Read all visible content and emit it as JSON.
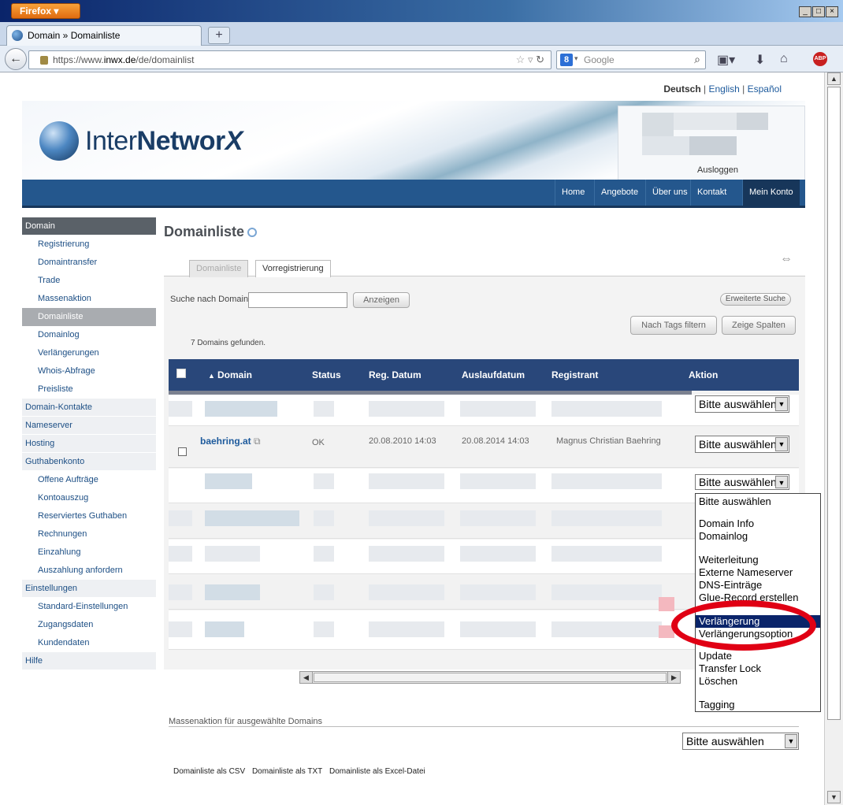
{
  "browser": {
    "app_button": "Firefox",
    "tab_title": "Domain » Domainliste",
    "url_prefix": "https://www.",
    "url_host": "inwx.de",
    "url_path": "/de/domainlist",
    "search_placeholder": "Google",
    "new_tab_label": "+"
  },
  "header": {
    "lang_current": "Deutsch",
    "lang_en": "English",
    "lang_es": "Español",
    "logo_light": "Inter",
    "logo_bold": "Networ",
    "logo_x": "X",
    "logout": "Ausloggen"
  },
  "topnav": [
    "Home",
    "Angebote",
    "Über uns",
    "Kontakt",
    "Mein Konto"
  ],
  "sidebar": [
    {
      "label": "Domain",
      "type": "section",
      "state": "dark"
    },
    {
      "label": "Registrierung",
      "type": "item"
    },
    {
      "label": "Domaintransfer",
      "type": "item"
    },
    {
      "label": "Trade",
      "type": "item"
    },
    {
      "label": "Massenaktion",
      "type": "item"
    },
    {
      "label": "Domainliste",
      "type": "item",
      "state": "active"
    },
    {
      "label": "Domainlog",
      "type": "item"
    },
    {
      "label": "Verlängerungen",
      "type": "item"
    },
    {
      "label": "Whois-Abfrage",
      "type": "item"
    },
    {
      "label": "Preisliste",
      "type": "item"
    },
    {
      "label": "Domain-Kontakte",
      "type": "section"
    },
    {
      "label": "Nameserver",
      "type": "section"
    },
    {
      "label": "Hosting",
      "type": "section"
    },
    {
      "label": "Guthabenkonto",
      "type": "section"
    },
    {
      "label": "Offene Aufträge",
      "type": "item"
    },
    {
      "label": "Kontoauszug",
      "type": "item"
    },
    {
      "label": "Reserviertes Guthaben",
      "type": "item"
    },
    {
      "label": "Rechnungen",
      "type": "item"
    },
    {
      "label": "Einzahlung",
      "type": "item"
    },
    {
      "label": "Auszahlung anfordern",
      "type": "item"
    },
    {
      "label": "Einstellungen",
      "type": "section"
    },
    {
      "label": "Standard-Einstellungen",
      "type": "item"
    },
    {
      "label": "Zugangsdaten",
      "type": "item"
    },
    {
      "label": "Kundendaten",
      "type": "item"
    },
    {
      "label": "Hilfe",
      "type": "section"
    }
  ],
  "main": {
    "title": "Domainliste",
    "tabs": [
      "Domainliste",
      "Vorregistrierung"
    ],
    "search_label": "Suche nach Domain:",
    "show_button": "Anzeigen",
    "advanced_search": "Erweiterte Suche",
    "filter_tags": "Nach Tags filtern",
    "show_columns": "Zeige Spalten",
    "found_text": "7 Domains gefunden."
  },
  "table": {
    "columns": [
      "Domain",
      "Status",
      "Reg. Datum",
      "Auslaufdatum",
      "Registrant",
      "Aktion"
    ],
    "row": {
      "domain": "baehring.at",
      "status": "OK",
      "reg_date": "20.08.2010 14:03",
      "exp_date": "20.08.2014 14:03",
      "registrant": "Magnus Christian Baehring"
    },
    "select_default": "Bitte auswählen"
  },
  "dropdown": {
    "items": [
      "Bitte auswählen",
      "Domain Info",
      "Domainlog",
      "Weiterleitung",
      "Externe Nameserver",
      "DNS-Einträge",
      "Glue-Record erstellen",
      "Verlängerung",
      "Verlängerungsoption",
      "Update",
      "Transfer Lock",
      "Löschen",
      "Tagging"
    ],
    "highlighted": "Verlängerung"
  },
  "footer": {
    "mass_action_label": "Massenaktion für ausgewählte Domains",
    "mass_select": "Bitte auswählen",
    "exports": [
      "Domainliste als CSV",
      "Domainliste als TXT",
      "Domainliste als Excel-Datei"
    ]
  }
}
